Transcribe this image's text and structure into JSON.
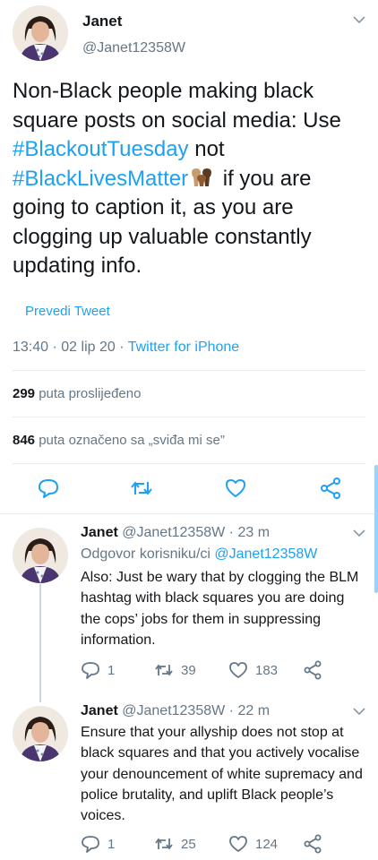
{
  "main": {
    "name": "Janet",
    "handle": "@Janet12358W",
    "text_1": "Non-Black people making black square posts on social media: Use ",
    "hashtag_1": "#BlackoutTuesday",
    "text_2": " not ",
    "hashtag_2": "#BlackLivesMatter",
    "text_3": " if you are going to caption it, as you are clogging up valuable constantly updating info.",
    "translate_label": "Prevedi Tweet",
    "time": "13:40",
    "date": "02 lip 20",
    "source": "Twitter for iPhone",
    "retweets_count": "299",
    "retweets_label": "puta proslijeđeno",
    "likes_count": "846",
    "likes_label": "puta označeno sa „sviđa mi se”",
    "icons": [
      "reply-icon",
      "retweet-icon",
      "like-icon",
      "share-icon",
      "chevron-down-icon",
      "raised-fists-emoji"
    ]
  },
  "replies": [
    {
      "name": "Janet",
      "handle": "@Janet12358W",
      "age": "23 m",
      "reply_prefix": "Odgovor korisniku/ci ",
      "reply_to": "@Janet12358W",
      "text": "Also: Just be wary that by clogging the BLM hashtag with black squares you are doing the cops’ jobs for them in suppressing information.",
      "reply_count": "1",
      "retweet_count": "39",
      "like_count": "183"
    },
    {
      "name": "Janet",
      "handle": "@Janet12358W",
      "age": "22 m",
      "text": "Ensure that your allyship does not stop at black squares and that you actively vocalise your denouncement of white supremacy and police brutality, and uplift Black people’s voices.",
      "reply_count": "1",
      "retweet_count": "25",
      "like_count": "124"
    }
  ],
  "colors": {
    "accent": "#1da1f2",
    "secondary_text": "#657786",
    "primary_text": "#14171a",
    "divider": "#e6ecf0"
  }
}
